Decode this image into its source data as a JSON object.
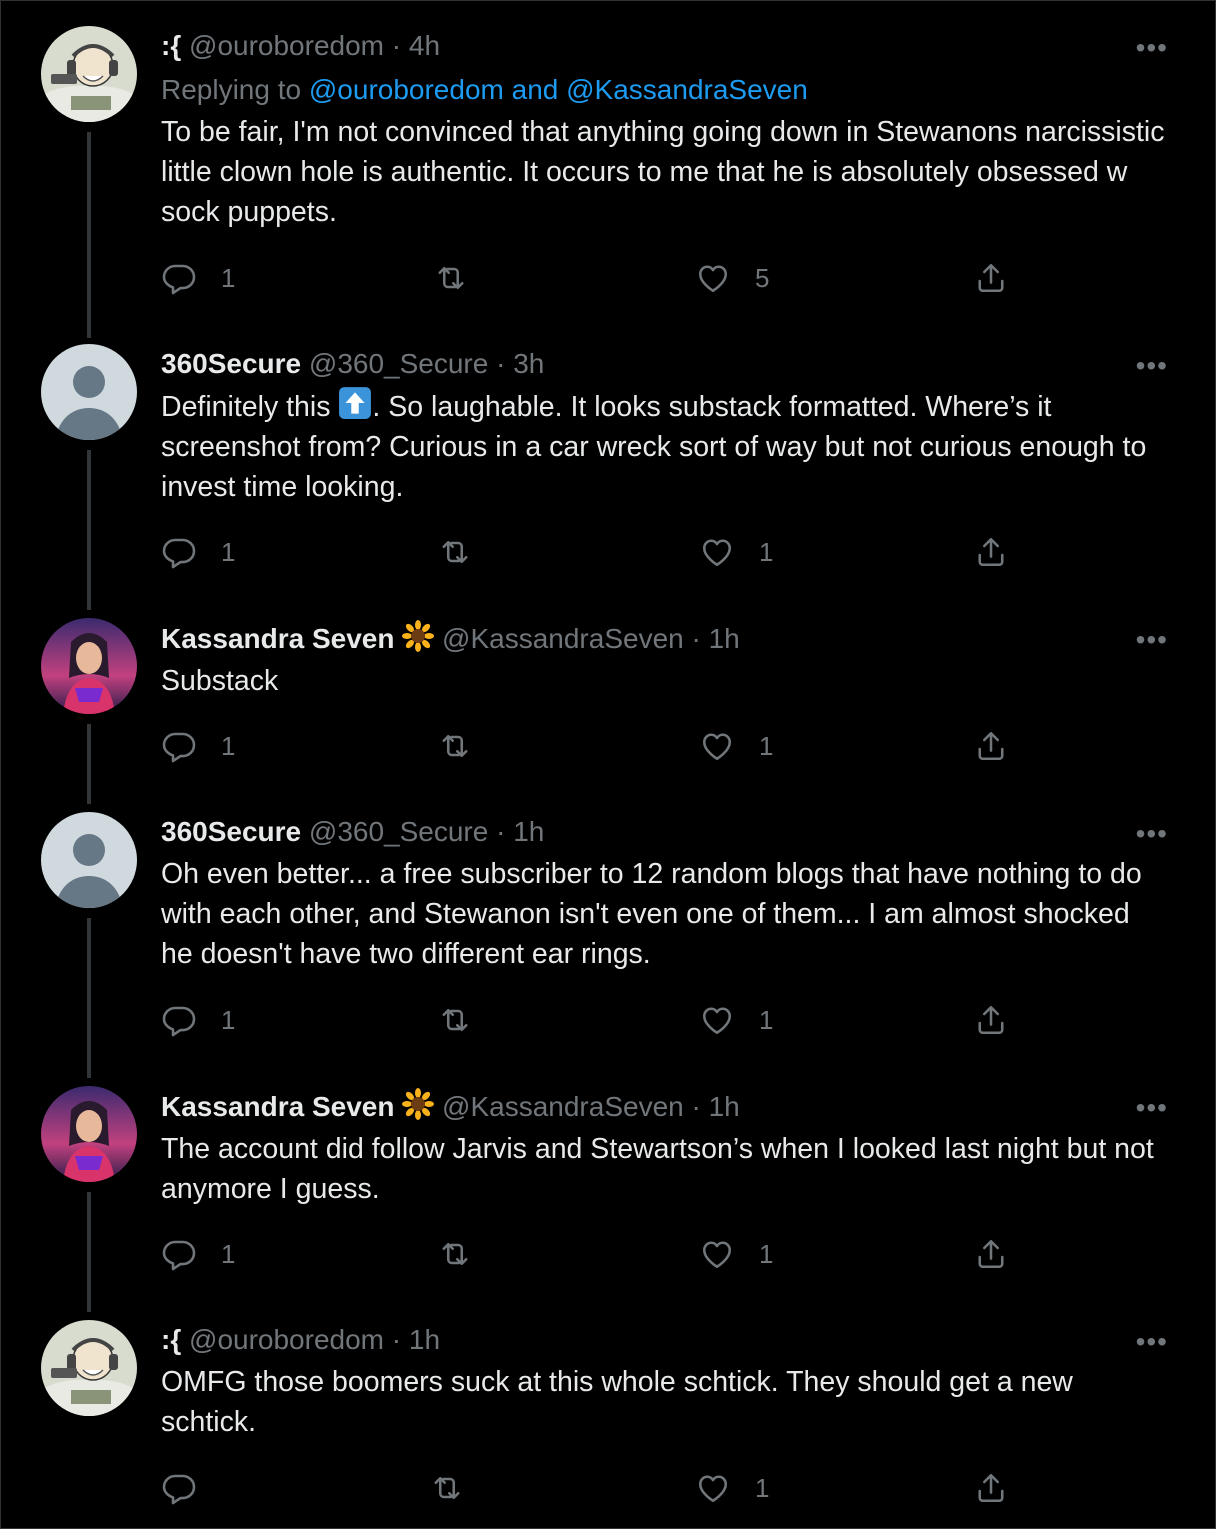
{
  "tweets": [
    {
      "avatar": "ouroboredom-avatar",
      "display_name": ":{",
      "handle": "@ouroboredom",
      "time": "4h",
      "replying_label": "Replying to",
      "replying_to": "@ouroboredom and @KassandraSeven",
      "text": "To be fair, I'm not convinced that anything going down in Stewanons narcissistic little clown hole is authentic. It occurs to me that he is absolutely obsessed w sock puppets.",
      "replies": "1",
      "retweets": "",
      "likes": "5"
    },
    {
      "avatar": "default-avatar",
      "display_name": "360Secure",
      "handle": "@360_Secure",
      "time": "3h",
      "text_before_emoji": "Definitely this ",
      "emoji": "up-arrow-emoji",
      "text_after_emoji": ".  So laughable.  It looks substack formatted.  Where’s it screenshot from?  Curious in a car wreck sort of way but not curious enough to invest time looking.",
      "replies": "1",
      "retweets": "",
      "likes": "1"
    },
    {
      "avatar": "kassandra-avatar",
      "display_name": "Kassandra Seven",
      "name_emoji": "sunflower-emoji",
      "handle": "@KassandraSeven",
      "time": "1h",
      "text": "Substack",
      "replies": "1",
      "retweets": "",
      "likes": "1"
    },
    {
      "avatar": "default-avatar",
      "display_name": "360Secure",
      "handle": "@360_Secure",
      "time": "1h",
      "text": "Oh even better... a free subscriber to 12 random blogs that have nothing to do with each other, and Stewanon isn't even one of them... I am almost shocked he doesn't have two different ear rings.",
      "replies": "1",
      "retweets": "",
      "likes": "1"
    },
    {
      "avatar": "kassandra-avatar",
      "display_name": "Kassandra Seven",
      "name_emoji": "sunflower-emoji",
      "handle": "@KassandraSeven",
      "time": "1h",
      "text": "The account did follow Jarvis and Stewartson’s when I looked last night but not anymore I guess.",
      "replies": "1",
      "retweets": "",
      "likes": "1"
    },
    {
      "avatar": "ouroboredom-avatar",
      "display_name": ":{",
      "handle": "@ouroboredom",
      "time": "1h",
      "text": "OMFG those boomers suck at this whole schtick. They should get a new schtick.",
      "replies": "",
      "retweets": "",
      "likes": "1"
    }
  ],
  "separator": "·",
  "more_label": "•••",
  "colors": {
    "background": "#000000",
    "text": "#e7e9ea",
    "secondary": "#71767b",
    "link": "#1d9bf0",
    "thread_line": "#333639"
  }
}
